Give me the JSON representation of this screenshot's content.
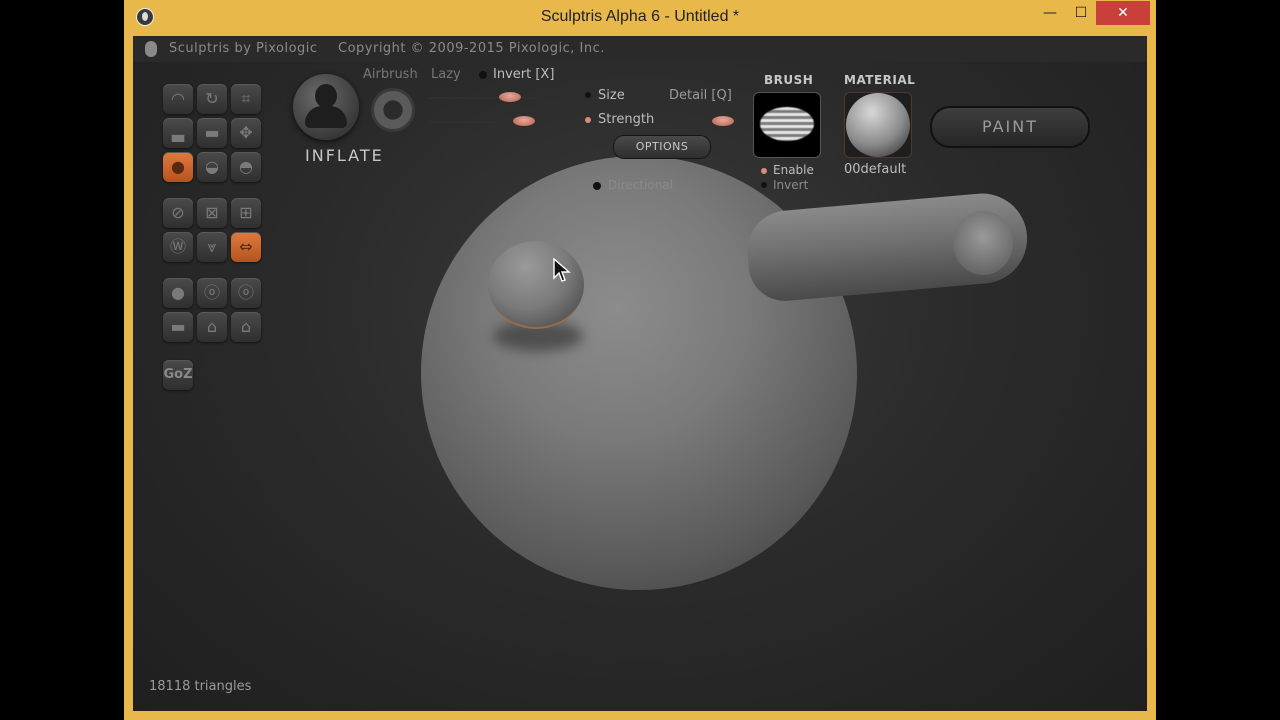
{
  "window": {
    "title": "Sculptris Alpha 6 - Untitled *",
    "minimize_glyph": "—",
    "maximize_glyph": "☐",
    "close_glyph": "✕"
  },
  "header": {
    "app_name": "Sculptris by Pixologic",
    "copyright": "Copyright © 2009-2015 Pixologic, Inc."
  },
  "toolbar": {
    "goz_label": "GoZ",
    "tools": [
      {
        "name": "tool-draw",
        "icon": "draw-icon",
        "glyph": "◠"
      },
      {
        "name": "tool-rotate",
        "icon": "rotate-icon",
        "glyph": "↻"
      },
      {
        "name": "tool-crop",
        "icon": "crop-icon",
        "glyph": "⌗"
      },
      {
        "name": "tool-flatten",
        "icon": "flatten-icon",
        "glyph": "▃"
      },
      {
        "name": "tool-pinch",
        "icon": "pinch-icon",
        "glyph": "▬"
      },
      {
        "name": "tool-grab",
        "icon": "grab-icon",
        "glyph": "✥"
      },
      {
        "name": "tool-inflate",
        "icon": "inflate-icon",
        "glyph": "●"
      },
      {
        "name": "tool-crease",
        "icon": "crease-icon",
        "glyph": "◒"
      },
      {
        "name": "tool-smooth",
        "icon": "smooth-icon",
        "glyph": "◓"
      },
      {
        "name": "tool-symmetry",
        "icon": "symmetry-icon",
        "glyph": "⊘"
      },
      {
        "name": "tool-reduce",
        "icon": "reduce-icon",
        "glyph": "⊠"
      },
      {
        "name": "tool-subdivide",
        "icon": "subdivide-icon",
        "glyph": "⊞"
      },
      {
        "name": "tool-wireframe",
        "icon": "wireframe-icon",
        "glyph": "Ⓦ"
      },
      {
        "name": "tool-reduce-brush",
        "icon": "reduce-brush-icon",
        "glyph": "⩔"
      },
      {
        "name": "tool-mirror",
        "icon": "mirror-icon",
        "glyph": "⇔"
      },
      {
        "name": "tool-new-sphere",
        "icon": "new-sphere-icon",
        "glyph": "●"
      },
      {
        "name": "tool-import-obj",
        "icon": "import-obj-icon",
        "glyph": "ⓞ"
      },
      {
        "name": "tool-export-obj",
        "icon": "export-obj-icon",
        "glyph": "ⓞ"
      },
      {
        "name": "tool-new-plane",
        "icon": "new-plane-icon",
        "glyph": "▬"
      },
      {
        "name": "tool-open",
        "icon": "open-icon",
        "glyph": "⌂"
      },
      {
        "name": "tool-save",
        "icon": "save-icon",
        "glyph": "⌂"
      }
    ]
  },
  "brush": {
    "name": "INFLATE",
    "airbrush_label": "Airbrush",
    "lazy_label": "Lazy",
    "invert_label": "Invert [X]",
    "size_label": "Size",
    "strength_label": "Strength",
    "detail_label": "Detail [Q]",
    "options_label": "OPTIONS",
    "directional_label": "Directional"
  },
  "brush_panel": {
    "title": "BRUSH",
    "enable_label": "Enable",
    "invert_label": "Invert"
  },
  "material_panel": {
    "title": "MATERIAL",
    "name": "00default"
  },
  "paint_button": "PAINT",
  "status": {
    "triangles": "18118 triangles"
  },
  "colors": {
    "accent": "#d06a35",
    "title_bar": "#e8b84a",
    "viewport": "#2b2b2b",
    "close_button": "#c9403a"
  }
}
